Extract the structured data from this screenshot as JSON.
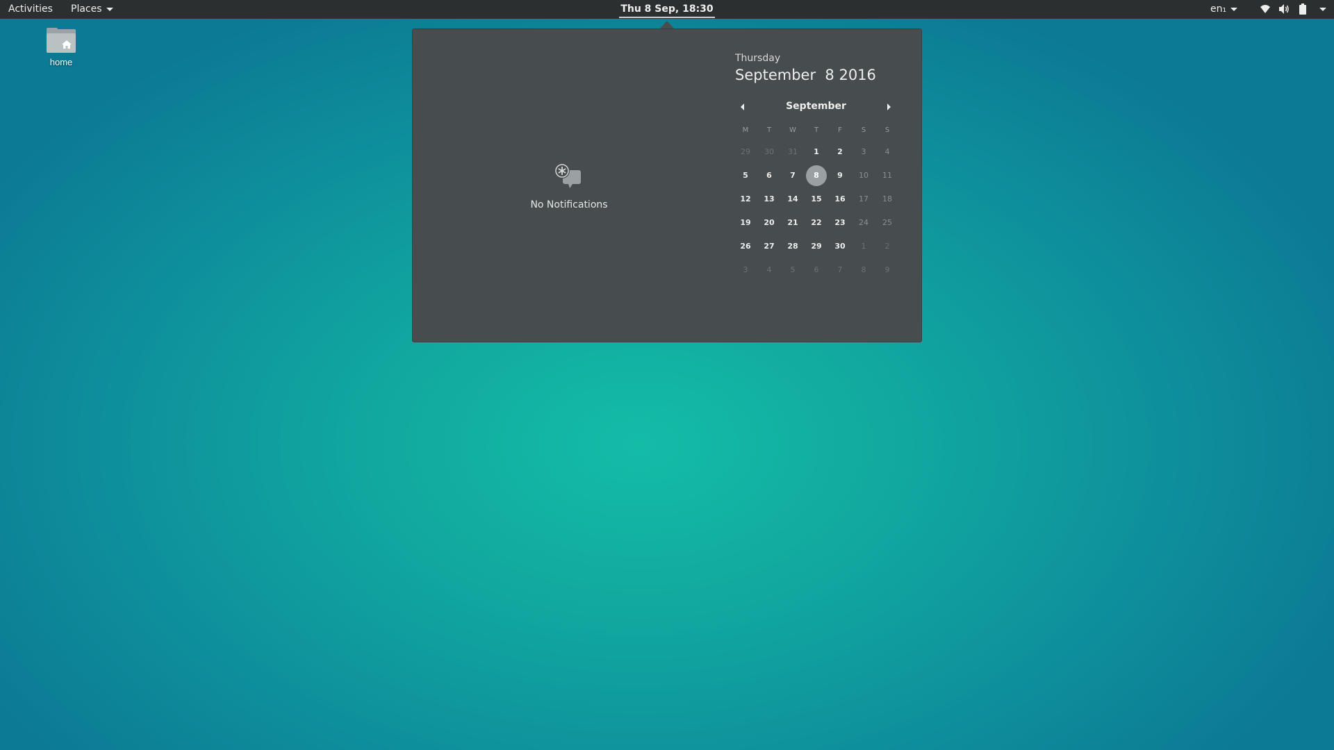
{
  "topbar": {
    "activities": "Activities",
    "places": "Places",
    "clock": "Thu  8 Sep, 18:30",
    "lang": "en₁",
    "icons": [
      "wifi-icon",
      "volume-icon",
      "battery-icon"
    ]
  },
  "desktop": {
    "home_label": "home",
    "folder_icon": "home-folder-icon"
  },
  "popup": {
    "notifications": {
      "label": "No Notifications",
      "icon": "notifications-icon"
    },
    "date": {
      "weekday": "Thursday",
      "full": "September  8 2016"
    },
    "calendar": {
      "month": "September",
      "weekdays": [
        "M",
        "T",
        "W",
        "T",
        "F",
        "S",
        "S"
      ],
      "weeks": [
        [
          "29",
          "30",
          "31",
          "1",
          "2",
          "3",
          "4"
        ],
        [
          "5",
          "6",
          "7",
          "8",
          "9",
          "10",
          "11"
        ],
        [
          "12",
          "13",
          "14",
          "15",
          "16",
          "17",
          "18"
        ],
        [
          "19",
          "20",
          "21",
          "22",
          "23",
          "24",
          "25"
        ],
        [
          "26",
          "27",
          "28",
          "29",
          "30",
          "1",
          "2"
        ],
        [
          "3",
          "4",
          "5",
          "6",
          "7",
          "8",
          "9"
        ]
      ],
      "today": "8"
    }
  },
  "colors": {
    "topbar": "#2b2f30",
    "popup": "#474c4e",
    "desktop": "#14bca8"
  }
}
